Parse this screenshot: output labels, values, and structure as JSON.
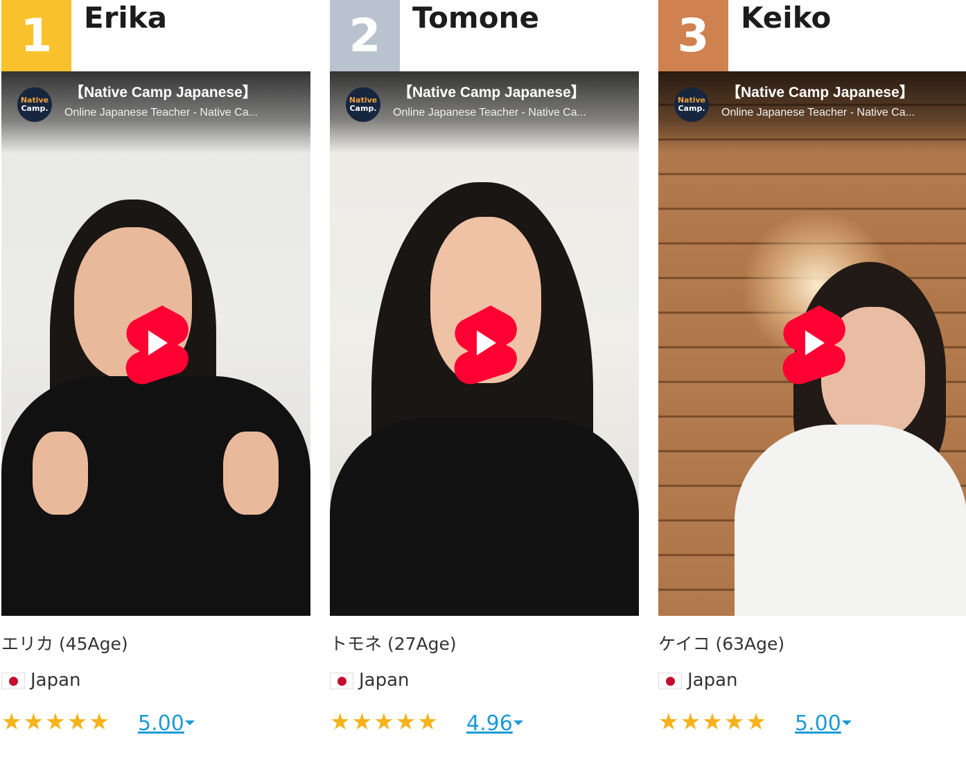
{
  "colors": {
    "rank_1": "#f9c22c",
    "rank_2": "#b9c2cf",
    "rank_3": "#cf8150",
    "star": "#f5b21a",
    "link": "#1c9ad6",
    "shorts_red": "#ff0033"
  },
  "teachers": [
    {
      "rank": "1",
      "name": "Erika",
      "video": {
        "channel_logo_line1": "Native",
        "channel_logo_line2": "Camp.",
        "title": "【Native Camp Japanese】",
        "subtitle": "Online Japanese Teacher - Native Ca...",
        "play_icon": "youtube-shorts-play-icon"
      },
      "kana_age": "エリカ (45Age)",
      "country": "Japan",
      "flag_icon": "japan-flag-icon",
      "stars": "★★★★★",
      "rating": "5.00"
    },
    {
      "rank": "2",
      "name": "Tomone",
      "video": {
        "channel_logo_line1": "Native",
        "channel_logo_line2": "Camp.",
        "title": "【Native Camp Japanese】",
        "subtitle": "Online Japanese Teacher - Native Ca...",
        "play_icon": "youtube-shorts-play-icon"
      },
      "kana_age": "トモネ (27Age)",
      "country": "Japan",
      "flag_icon": "japan-flag-icon",
      "stars": "★★★★★",
      "rating": "4.96"
    },
    {
      "rank": "3",
      "name": "Keiko",
      "video": {
        "channel_logo_line1": "Native",
        "channel_logo_line2": "Camp.",
        "title": "【Native Camp Japanese】",
        "subtitle": "Online Japanese Teacher - Native Ca...",
        "play_icon": "youtube-shorts-play-icon"
      },
      "kana_age": "ケイコ (63Age)",
      "country": "Japan",
      "flag_icon": "japan-flag-icon",
      "stars": "★★★★★",
      "rating": "5.00"
    }
  ]
}
